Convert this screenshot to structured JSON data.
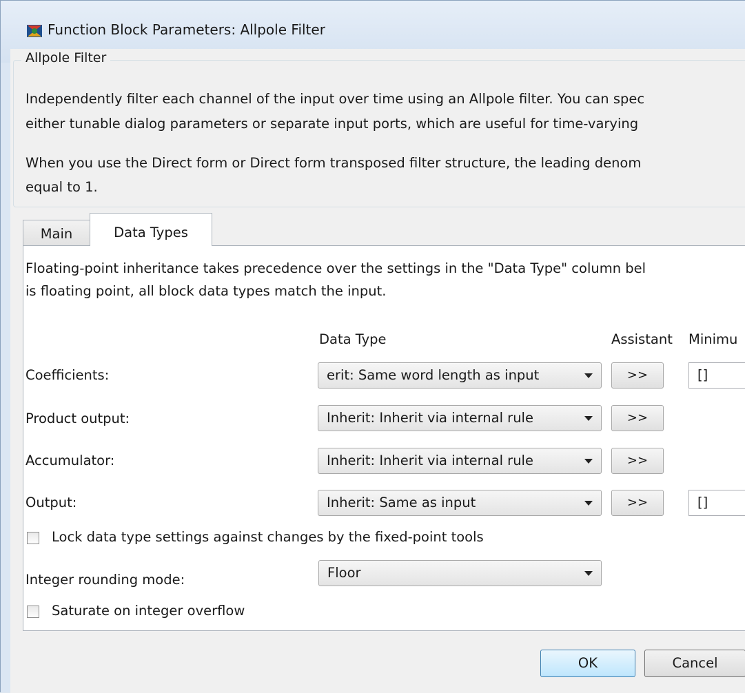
{
  "window": {
    "title": "Function Block Parameters: Allpole Filter",
    "icon": "simulink-block-icon"
  },
  "group": {
    "legend": "Allpole Filter",
    "desc_lines": [
      "Independently filter each channel of the input over time using an Allpole filter. You can spec",
      "either tunable dialog parameters or separate input ports, which are useful for time-varying",
      "When you use the Direct form or Direct form transposed filter structure, the leading denom",
      "equal to 1."
    ]
  },
  "tabs": [
    {
      "label": "Main",
      "active": false
    },
    {
      "label": "Data Types",
      "active": true
    }
  ],
  "panel": {
    "intro_lines": [
      "Floating-point inheritance takes precedence over the settings in the \"Data Type\" column bel",
      "is floating point, all block data types match the input."
    ],
    "headers": {
      "data_type": "Data Type",
      "assistant": "Assistant",
      "minimum": "Minimu"
    },
    "rows": [
      {
        "label": "Coefficients:",
        "value": "erit: Same word length as input",
        "assistant": ">>",
        "minimum": "[]"
      },
      {
        "label": "Product output:",
        "value": "Inherit: Inherit via internal rule",
        "assistant": ">>",
        "minimum": ""
      },
      {
        "label": "Accumulator:",
        "value": "Inherit: Inherit via internal rule",
        "assistant": ">>",
        "minimum": ""
      },
      {
        "label": "Output:",
        "value": "Inherit: Same as input",
        "assistant": ">>",
        "minimum": "[]"
      }
    ],
    "lock_checkbox": {
      "label": "Lock data type settings against changes by the fixed-point tools",
      "checked": false
    },
    "rounding": {
      "label": "Integer rounding mode:",
      "value": "Floor"
    },
    "saturate_checkbox": {
      "label": "Saturate on integer overflow",
      "checked": false
    }
  },
  "buttons": {
    "ok": "OK",
    "cancel": "Cancel"
  },
  "colors": {
    "title_bg": "#dbe6f3",
    "client_bg": "#f0f0f0",
    "ok_accent": "#3c7fb1"
  }
}
